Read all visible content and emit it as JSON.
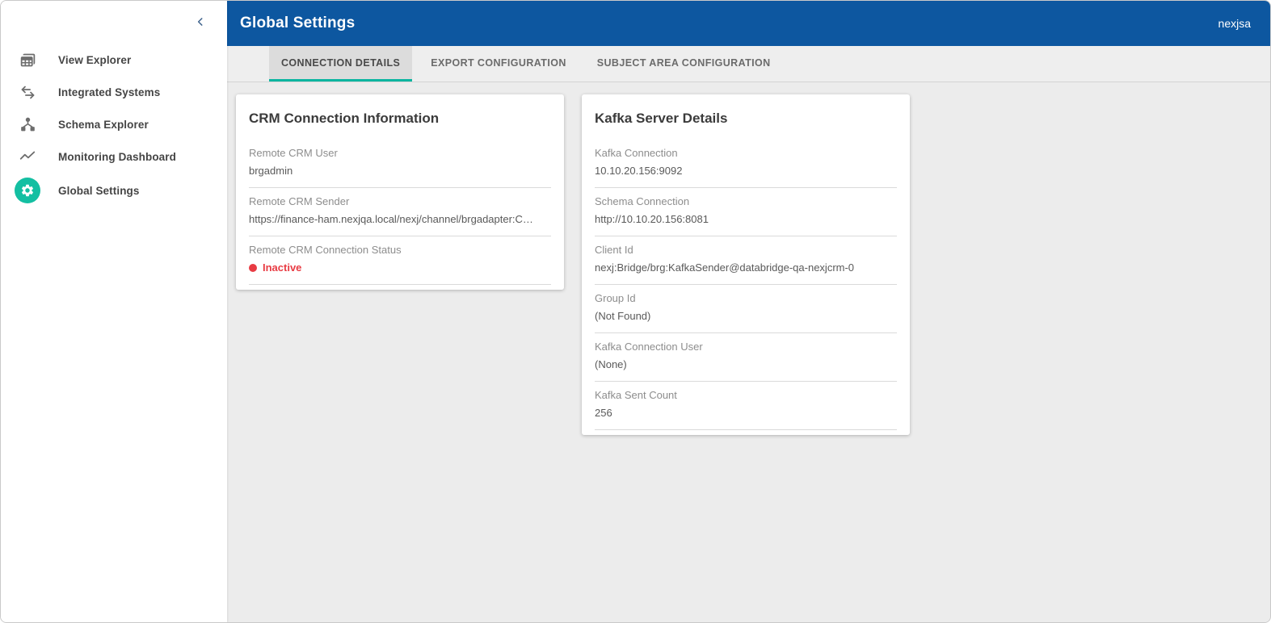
{
  "colors": {
    "header_bg": "#0d57a0",
    "accent_teal": "#14bfa2",
    "tab_underline_teal": "#0ab5a0",
    "status_red": "#e83b43"
  },
  "sidebar": {
    "items": [
      {
        "label": "View Explorer",
        "icon": "view-explorer-icon",
        "active": false
      },
      {
        "label": "Integrated Systems",
        "icon": "integrated-systems-icon",
        "active": false
      },
      {
        "label": "Schema Explorer",
        "icon": "schema-explorer-icon",
        "active": false
      },
      {
        "label": "Monitoring Dashboard",
        "icon": "monitoring-dashboard-icon",
        "active": false
      },
      {
        "label": "Global Settings",
        "icon": "gear-icon",
        "active": true
      }
    ]
  },
  "header": {
    "title": "Global Settings",
    "user": "nexjsa"
  },
  "tabs": [
    {
      "label": "CONNECTION DETAILS",
      "active": true
    },
    {
      "label": "EXPORT CONFIGURATION",
      "active": false
    },
    {
      "label": "SUBJECT AREA CONFIGURATION",
      "active": false
    }
  ],
  "cards": [
    {
      "title": "CRM Connection Information",
      "fields": [
        {
          "label": "Remote CRM User",
          "value": "brgadmin"
        },
        {
          "label": "Remote CRM Sender",
          "value": "https://finance-ham.nexjqa.local/nexj/channel/brgadapter:C…"
        },
        {
          "label": "Remote CRM Connection Status",
          "value": "Inactive",
          "status": "inactive"
        }
      ]
    },
    {
      "title": "Kafka Server Details",
      "fields": [
        {
          "label": "Kafka Connection",
          "value": "10.10.20.156:9092"
        },
        {
          "label": "Schema Connection",
          "value": "http://10.10.20.156:8081"
        },
        {
          "label": "Client Id",
          "value": "nexj:Bridge/brg:KafkaSender@databridge-qa-nexjcrm-0"
        },
        {
          "label": "Group Id",
          "value": "(Not Found)"
        },
        {
          "label": "Kafka Connection User",
          "value": "(None)"
        },
        {
          "label": "Kafka Sent Count",
          "value": "256"
        }
      ]
    }
  ]
}
